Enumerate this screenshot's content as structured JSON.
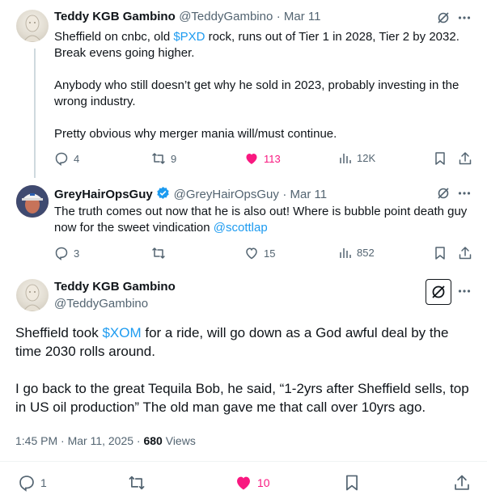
{
  "tweet1": {
    "name": "Teddy KGB Gambino",
    "handle": "@TeddyGambino",
    "date": "· Mar 11",
    "text_a": "Sheffield on cnbc, old ",
    "cashtag": "$PXD",
    "text_b": " rock, runs out of Tier 1 in 2028, Tier 2 by 2032. Break evens going higher.\n\nAnybody who still doesn’t get why he sold in 2023, probably investing in the wrong industry.\n\nPretty obvious why merger mania will/must continue.",
    "replies": "4",
    "reposts": "9",
    "likes": "113",
    "views": "12K"
  },
  "tweet2": {
    "name": "GreyHairOpsGuy",
    "handle": "@GreyHairOpsGuy",
    "date": "· Mar 11",
    "text_a": "The truth comes out now that he is also out!  Where is bubble point death guy now for the sweet vindication ",
    "mention": "@scottlap",
    "replies": "3",
    "reposts": "",
    "likes": "15",
    "views": "852"
  },
  "tweet3": {
    "name": "Teddy KGB Gambino",
    "handle": "@TeddyGambino",
    "text_a": "Sheffield took  ",
    "cashtag": "$XOM",
    "text_b": " for a ride, will go down as a God awful deal by the time 2030 rolls around.\n\nI go back to the great Tequila Bob, he said, “1-2yrs after Sheffield sells, top in US oil production” The old man gave me that call over 10yrs ago.",
    "time": "1:45 PM · Mar 11, 2025 · ",
    "views_count": "680",
    "views_label": " Views",
    "replies": "1",
    "reposts": "",
    "likes": "10"
  },
  "colors": {
    "accent": "#1d9bf0",
    "like": "#f91880",
    "muted": "#536471"
  }
}
